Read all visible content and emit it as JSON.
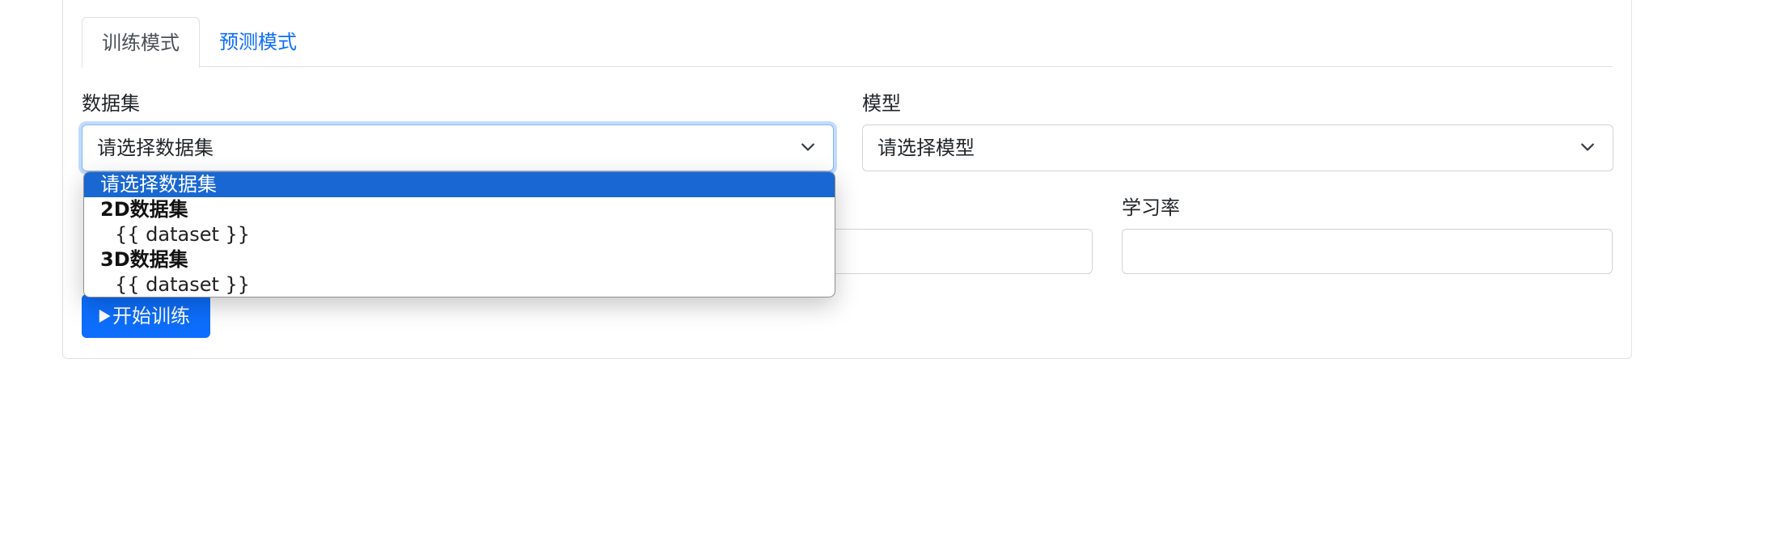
{
  "tabs": [
    {
      "label": "训练模式",
      "active": true
    },
    {
      "label": "预测模式",
      "active": false
    }
  ],
  "dataset": {
    "label": "数据集",
    "selected": "请选择数据集",
    "options": {
      "placeholder": "请选择数据集",
      "group_2d": "2D数据集",
      "item_2d": "{{ dataset }}",
      "group_3d": "3D数据集",
      "item_3d": "{{ dataset }}"
    }
  },
  "model": {
    "label": "模型",
    "selected": "请选择模型"
  },
  "learning_rate": {
    "label": "学习率",
    "value": ""
  },
  "start_button": {
    "label": "开始训练",
    "icon": "play-icon"
  },
  "colors": {
    "primary": "#0d6efd",
    "option_highlight": "#1967d2",
    "border": "#ced4da",
    "focus_border": "#86b7fe"
  }
}
